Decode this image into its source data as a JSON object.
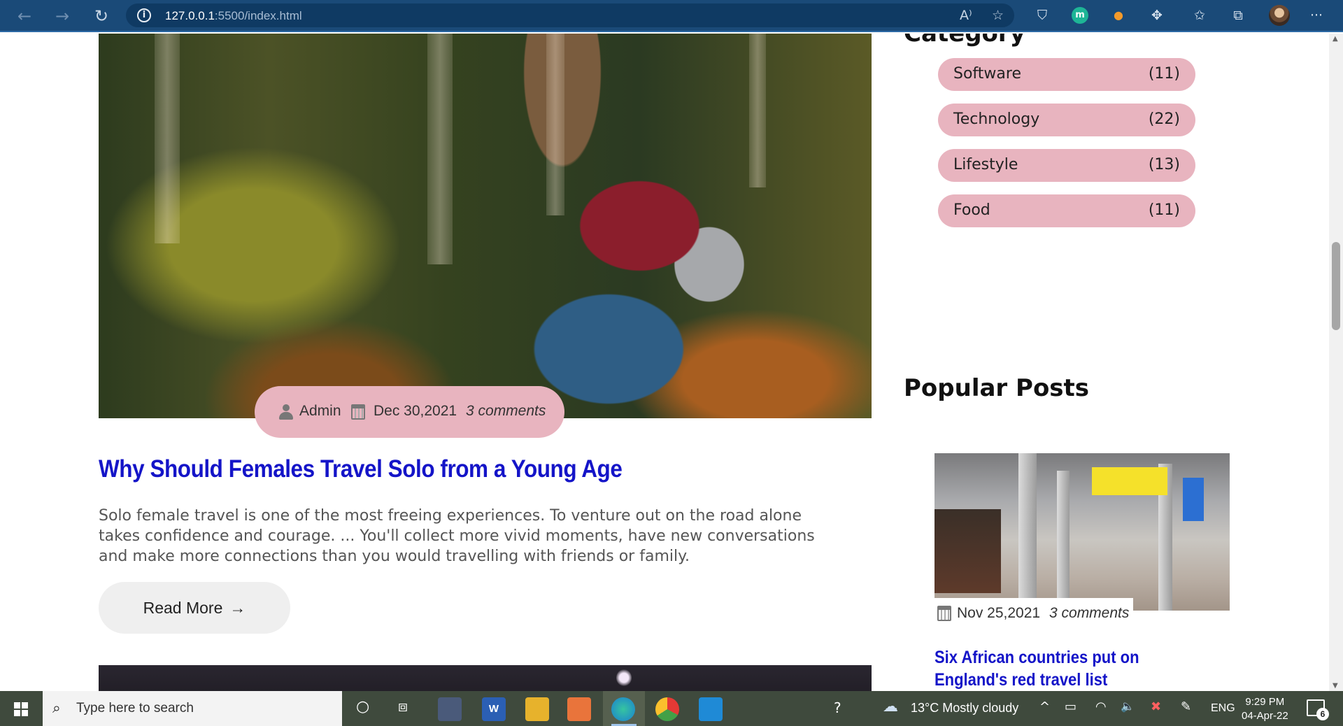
{
  "browser": {
    "url_host": "127.0.0.1",
    "url_path": ":5500/index.html",
    "back_icon": "←",
    "forward_icon": "→",
    "reload_icon": "↻",
    "info_icon": "i",
    "read_aloud_icon": "A⁾",
    "favorite_add_icon": "☆",
    "ext_shield_icon": "⛉",
    "ext_m_label": "m",
    "ext_dot_icon": "●",
    "extensions_icon": "✥",
    "favorites_icon": "✩",
    "collections_icon": "⧉",
    "more_icon": "···"
  },
  "post": {
    "author": "Admin",
    "date": "Dec 30,2021",
    "comments": "3 comments",
    "title": "Why Should Females Travel Solo from a Young Age",
    "excerpt": "Solo female travel is one of the most freeing experiences. To venture out on the road alone takes confidence and courage. ... You'll collect more vivid moments, have new conversations and make more connections than you would travelling with friends or family.",
    "read_more": "Read More",
    "read_more_icon": "→"
  },
  "sidebar": {
    "category_heading": "Category",
    "categories": [
      {
        "name": "Software",
        "count": "(11)"
      },
      {
        "name": "Technology",
        "count": "(22)"
      },
      {
        "name": "Lifestyle",
        "count": "(13)"
      },
      {
        "name": "Food",
        "count": "(11)"
      }
    ],
    "popular_heading": "Popular Posts",
    "popular": [
      {
        "date": "Nov 25,2021",
        "comments": "3 comments",
        "title": "Six African countries put on England's red travel list"
      }
    ]
  },
  "taskbar": {
    "search_placeholder": "Type here to search",
    "search_icon": "⌕",
    "cortana_icon": "○",
    "taskview_icon": "⧈",
    "app_word_label": "W",
    "help_icon": "?",
    "weather_icon": "☁",
    "weather": "13°C  Mostly cloudy",
    "tray_up_icon": "^",
    "battery_icon": "▭",
    "wifi_icon": "◠",
    "volume_icon": "🔈",
    "security_icon": "✖",
    "pen_icon": "✎",
    "language": "ENG",
    "time": "9:29 PM",
    "date": "04-Apr-22",
    "notification_count": "6"
  },
  "colors": {
    "chrome_bar": "#1a4a78",
    "pill_pink": "#e8b4bf",
    "title_blue": "#1414c8",
    "taskbar": "#3f4a3d"
  }
}
